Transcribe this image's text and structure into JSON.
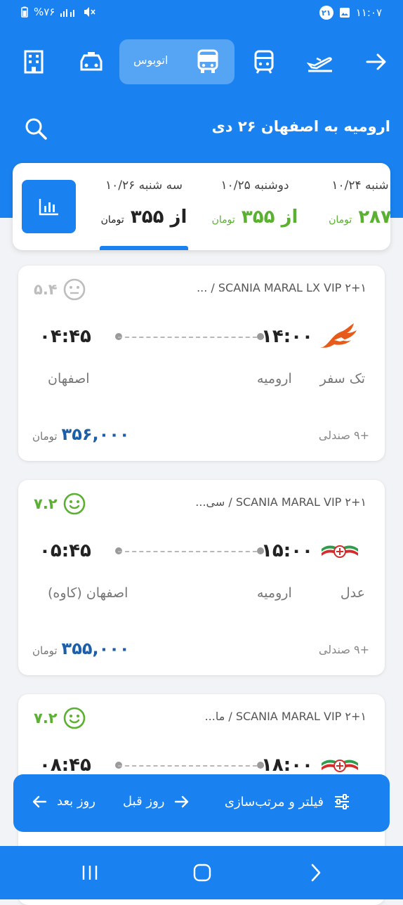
{
  "status_bar": {
    "time": "۱۱:۰۷",
    "battery": "%۷۶",
    "notification_count": "۲۱"
  },
  "transport_modes": [
    {
      "name": "hotel",
      "icon": "building-icon"
    },
    {
      "name": "taxi",
      "icon": "car-icon"
    },
    {
      "name": "bus",
      "icon": "bus-icon",
      "label": "اتوبوس",
      "active": true
    },
    {
      "name": "train",
      "icon": "train-icon"
    },
    {
      "name": "flight",
      "icon": "plane-icon"
    }
  ],
  "route": {
    "title": "ارومیه به اصفهان ۲۶ دی"
  },
  "dates": [
    {
      "day": "سه شنبه ۱۰/۲۶",
      "price_prefix": "از",
      "price": "۳۵۵",
      "unit": "تومان",
      "selected": true
    },
    {
      "day": "دوشنبه ۱۰/۲۵",
      "price_prefix": "از",
      "price": "۳۵۵",
      "unit": "تومان",
      "selected": false
    },
    {
      "day": "شنبه ۱۰/۲۴",
      "price_prefix": "",
      "price": "۲۸۷",
      "unit": "تومان",
      "selected": false
    }
  ],
  "trips": [
    {
      "bus_type": "SCANIA MARAL LX VIP ۲+۱ / ...",
      "rating": "۵.۴",
      "rating_color": "#bdbdbd",
      "departure_time": "۱۴:۰۰",
      "arrival_time": "۰۴:۴۵",
      "origin": "ارومیه",
      "destination": "اصفهان",
      "company": "تک سفر",
      "price": "۳۵۶,۰۰۰",
      "unit": "تومان",
      "seats": "+۹ صندلی"
    },
    {
      "bus_type": "SCANIA MARAL VIP ۲+۱ / سی...",
      "rating": "۷.۲",
      "rating_color": "#5ab031",
      "departure_time": "۱۵:۰۰",
      "arrival_time": "۰۵:۴۵",
      "origin": "ارومیه",
      "destination": "اصفهان (کاوه)",
      "company": "عدل",
      "price": "۳۵۵,۰۰۰",
      "unit": "تومان",
      "seats": "+۹ صندلی"
    },
    {
      "bus_type": "SCANIA MARAL VIP ۲+۱ / ما...",
      "rating": "۷.۲",
      "rating_color": "#5ab031",
      "departure_time": "۱۸:۰۰",
      "arrival_time": "۰۸:۴۵",
      "origin": "",
      "destination": "",
      "company": "",
      "price": "",
      "unit": "",
      "seats": ""
    }
  ],
  "bottom_bar": {
    "filter_label": "فیلتر و مرتب‌سازی",
    "prev_day_label": "روز قبل",
    "next_day_label": "روز بعد"
  },
  "colors": {
    "primary": "#1a82f0",
    "price_blue": "#1d5ea8",
    "green": "#5ab031"
  }
}
